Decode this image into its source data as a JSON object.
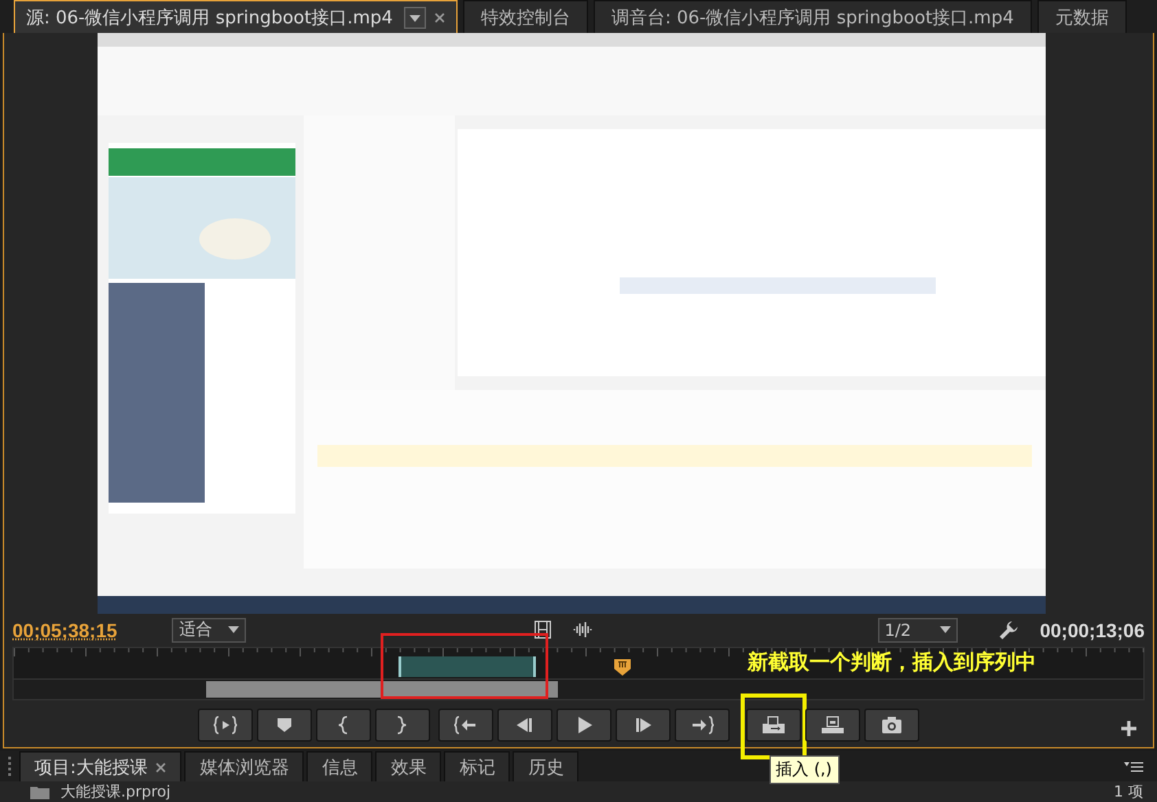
{
  "panel_tabs": [
    {
      "label": "源: 06-微信小程序调用 springboot接口.mp4",
      "selected": true,
      "closable": true
    },
    {
      "label": "特效控制台",
      "selected": false,
      "closable": false
    },
    {
      "label": "调音台: 06-微信小程序调用 springboot接口.mp4",
      "selected": false,
      "closable": false
    },
    {
      "label": "元数据",
      "selected": false,
      "closable": false
    }
  ],
  "monitor": {
    "current_timecode": "00;05;38;15",
    "zoom": "适合",
    "resolution": "1/2",
    "duration_timecode": "00;00;13;06"
  },
  "timeline": {
    "annotation": "新截取一个判断，插入到序列中"
  },
  "transport_buttons": [
    {
      "kind": "mark-in-out",
      "annotated": false
    },
    {
      "kind": "marker",
      "annotated": false
    },
    {
      "kind": "mark-in",
      "annotated": false
    },
    {
      "kind": "mark-out",
      "annotated": false
    },
    {
      "kind": "go-to-in",
      "annotated": false
    },
    {
      "kind": "step-back",
      "annotated": false
    },
    {
      "kind": "play",
      "annotated": false
    },
    {
      "kind": "step-forward",
      "annotated": false
    },
    {
      "kind": "go-to-out",
      "annotated": false
    },
    {
      "kind": "insert",
      "annotated": true,
      "tooltip": "插入 (,)"
    },
    {
      "kind": "overwrite",
      "annotated": false
    },
    {
      "kind": "export-frame",
      "annotated": false
    }
  ],
  "bottom_tabs": [
    {
      "label": "项目:大能授课",
      "selected": true,
      "closable": true
    },
    {
      "label": "媒体浏览器",
      "selected": false,
      "closable": false
    },
    {
      "label": "信息",
      "selected": false,
      "closable": false
    },
    {
      "label": "效果",
      "selected": false,
      "closable": false
    },
    {
      "label": "标记",
      "selected": false,
      "closable": false
    },
    {
      "label": "历史",
      "selected": false,
      "closable": false
    }
  ],
  "project": {
    "item": "大能授课.prproj",
    "count": "1 项"
  }
}
